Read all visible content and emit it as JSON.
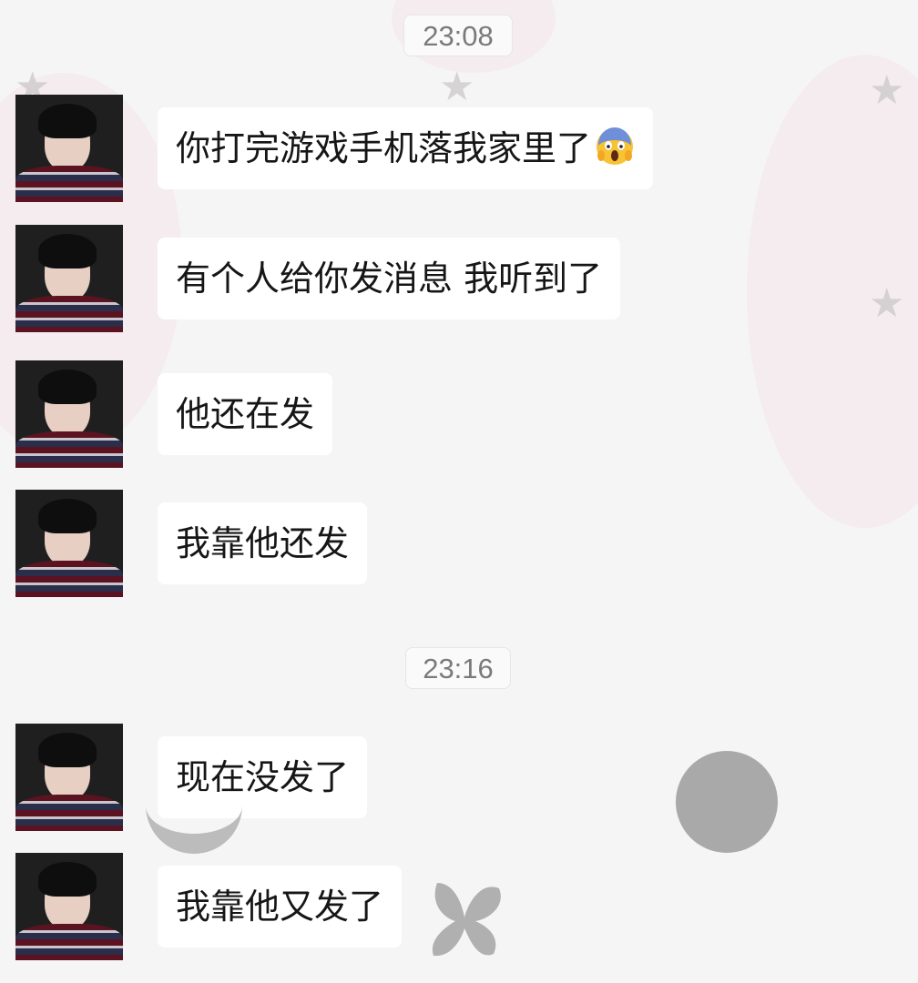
{
  "chat": {
    "timestamps": [
      "23:08",
      "23:16"
    ],
    "messages": [
      {
        "text": "你打完游戏手机落我家里了",
        "emoji": "face-screaming-in-fear"
      },
      {
        "text": "有个人给你发消息 我听到了"
      },
      {
        "text": "他还在发"
      },
      {
        "text": "我靠他还发"
      },
      {
        "text": "现在没发了"
      },
      {
        "text": "我靠他又发了"
      }
    ]
  },
  "colors": {
    "background": "#f6f5f6",
    "bubble": "#ffffff",
    "text": "#161616",
    "timestamp_text": "#7a7a7a",
    "decor_gray": "#a9a9a9"
  }
}
